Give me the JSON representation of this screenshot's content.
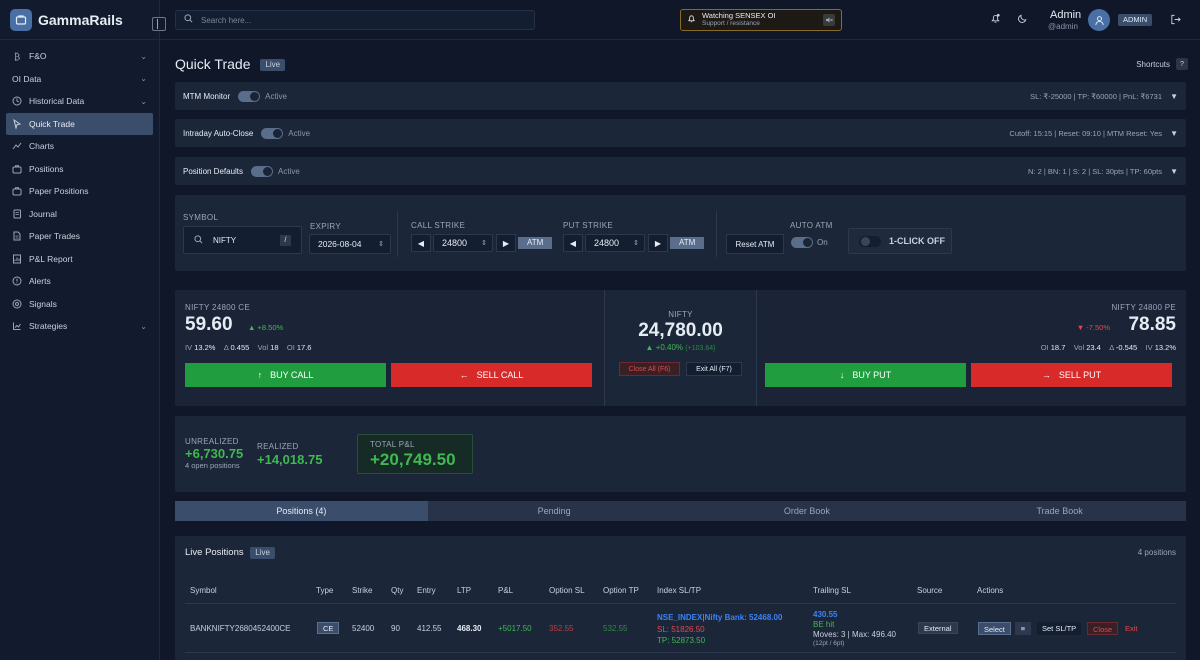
{
  "app": {
    "name": "GammaRails"
  },
  "sidebar": {
    "items": [
      {
        "label": "F&O",
        "icon": "bitcoin-icon",
        "chevron": true
      },
      {
        "label": "OI Data",
        "icon": "",
        "chevron": true
      },
      {
        "label": "Historical Data",
        "icon": "clock-icon",
        "chevron": true
      },
      {
        "label": "Quick Trade",
        "icon": "cursor-icon",
        "active": true
      },
      {
        "label": "Charts",
        "icon": "chart-icon"
      },
      {
        "label": "Positions",
        "icon": "briefcase-icon"
      },
      {
        "label": "Paper Positions",
        "icon": "briefcase-icon"
      },
      {
        "label": "Journal",
        "icon": "book-icon"
      },
      {
        "label": "Paper Trades",
        "icon": "document-icon"
      },
      {
        "label": "P&L Report",
        "icon": "report-icon"
      },
      {
        "label": "Alerts",
        "icon": "bell-icon"
      },
      {
        "label": "Signals",
        "icon": "signal-icon"
      },
      {
        "label": "Strategies",
        "icon": "strategy-icon",
        "chevron": true
      }
    ]
  },
  "topbar": {
    "search_placeholder": "Search here...",
    "watch_title": "Watching SENSEX OI",
    "watch_sub": "Support / resistance",
    "user_name": "Admin",
    "user_handle": "@admin",
    "role_badge": "ADMIN"
  },
  "page": {
    "title": "Quick Trade",
    "live_badge": "Live",
    "shortcuts": "Shortcuts",
    "shortcuts_key": "?"
  },
  "strips": [
    {
      "label": "MTM Monitor",
      "status": "Active",
      "summary": "SL: ₹-25000 | TP: ₹60000 | PnL: ₹6731"
    },
    {
      "label": "Intraday Auto-Close",
      "status": "Active",
      "summary": "Cutoff: 15:15 | Reset: 09:10 | MTM Reset: Yes"
    },
    {
      "label": "Position Defaults",
      "status": "Active",
      "summary": "N: 2 | BN: 1 | S: 2 | SL: 30pts | TP: 60pts"
    }
  ],
  "controls": {
    "symbol_label": "SYMBOL",
    "symbol_value": "NIFTY",
    "symbol_key": "/",
    "expiry_label": "EXPIRY",
    "expiry_value": "2026-08-04",
    "call_strike_label": "CALL STRIKE",
    "call_strike_value": "24800",
    "put_strike_label": "PUT STRIKE",
    "put_strike_value": "24800",
    "atm_label": "ATM",
    "reset_atm": "Reset ATM",
    "auto_atm_label": "AUTO ATM",
    "auto_atm_state": "On",
    "one_click": "1-CLICK OFF"
  },
  "call": {
    "title": "NIFTY 24800 CE",
    "price": "59.60",
    "change": "▲ +8.50%",
    "iv_label": "IV",
    "iv": "13.2%",
    "delta_label": "Δ",
    "delta": "0.455",
    "vol_label": "Vol",
    "vol": "18",
    "oi_label": "OI",
    "oi": "17.6",
    "buy": "BUY CALL",
    "sell": "SELL CALL"
  },
  "index": {
    "name": "NIFTY",
    "price": "24,780.00",
    "change": "▲ +0.40%",
    "change_abs": "(+103.64)",
    "close_all": "Close All (F6)",
    "exit_all": "Exit All (F7)"
  },
  "put": {
    "title": "NIFTY 24800 PE",
    "price": "78.85",
    "change": "▼ -7.50%",
    "oi_label": "OI",
    "oi": "18.7",
    "vol_label": "Vol",
    "vol": "23.4",
    "delta_label": "Δ",
    "delta": "-0.545",
    "iv_label": "IV",
    "iv": "13.2%",
    "buy": "BUY PUT",
    "sell": "SELL PUT"
  },
  "pnl": {
    "unrealized_label": "UNREALIZED",
    "unrealized": "+6,730.75",
    "open_positions": "4 open positions",
    "realized_label": "REALIZED",
    "realized": "+14,018.75",
    "total_label": "TOTAL P&L",
    "total": "+20,749.50"
  },
  "tabs": [
    "Positions (4)",
    "Pending",
    "Order Book",
    "Trade Book"
  ],
  "live_positions": {
    "title": "Live Positions",
    "badge": "Live",
    "count": "4 positions",
    "columns": [
      "Symbol",
      "Type",
      "Strike",
      "Qty",
      "Entry",
      "LTP",
      "P&L",
      "Option SL",
      "Option TP",
      "Index SL/TP",
      "Trailing SL",
      "Source",
      "Actions"
    ],
    "rows": [
      {
        "symbol": "BANKNIFTY2680452400CE",
        "type": "CE",
        "strike": "52400",
        "qty": "90",
        "entry": "412.55",
        "ltp": "468.30",
        "pnl": "+5017.50",
        "option_sl": "352.55",
        "option_tp": "532.55",
        "index_name": "NSE_INDEX|Nifty Bank: 52468.00",
        "index_sl": "SL: 51826.50",
        "index_tp": "TP: 52873.50",
        "trail_value": "430.55",
        "trail_status": "BE hit",
        "trail_moves": "Moves: 3 | Max: 496.40",
        "trail_params": "(12pt / 6pt)",
        "source": "External",
        "select": "Select",
        "set_sltp": "Set SL/TP",
        "close": "Close",
        "exit": "Exit"
      }
    ]
  },
  "colors": {
    "accent": "#3a4d6b",
    "buy": "#1f9d3f",
    "sell": "#d92a2a",
    "profit": "#3fb950",
    "loss": "#e5484d"
  }
}
